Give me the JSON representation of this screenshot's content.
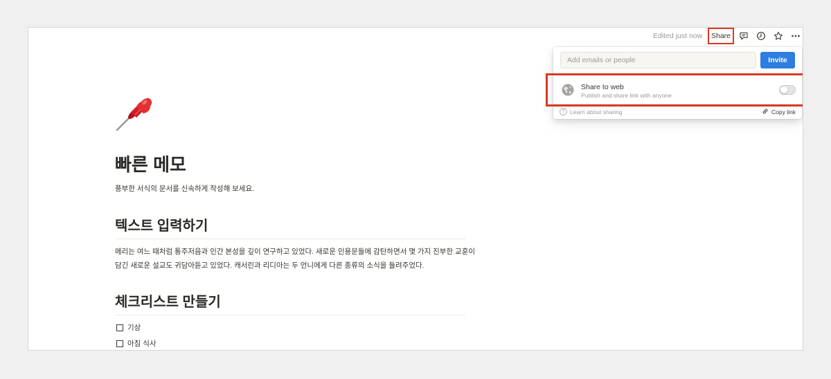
{
  "topbar": {
    "edited": "Edited just now",
    "share_label": "Share",
    "icons": [
      "comment-icon",
      "history-icon",
      "star-icon",
      "more-icon"
    ]
  },
  "share_popup": {
    "invite_placeholder": "Add emails or people",
    "invite_label": "Invite",
    "web_title": "Share to web",
    "web_sub": "Publish and share link with anyone",
    "web_enabled": false,
    "learn_label": "Learn about sharing",
    "copy_link_label": "Copy link"
  },
  "page": {
    "icon": "pushpin-icon",
    "title": "빠른 메모",
    "subtitle": "풍부한 서식의 문서를 신속하게 작성해 보세요.",
    "section1_title": "텍스트 입력하기",
    "section1_paragraph": "메리는 여느 때처럼 통주저음과 인간 본성을 깊이 연구하고 있었다. 새로운 인용문들에 감탄하면서 몇 가지 진부한 교훈이 담긴 새로운 설교도 귀담아듣고 있었다. 캐서린과 리디아는 두 언니에게 다른 종류의 소식을 들려주었다.",
    "section2_title": "체크리스트 만들기",
    "checklist": [
      {
        "label": "기상",
        "checked": false
      },
      {
        "label": "아침 식사",
        "checked": false
      }
    ]
  },
  "colors": {
    "accent": "#2e7de0",
    "highlight": "#d93822",
    "text": "#37352f",
    "muted": "#9b9a97"
  }
}
